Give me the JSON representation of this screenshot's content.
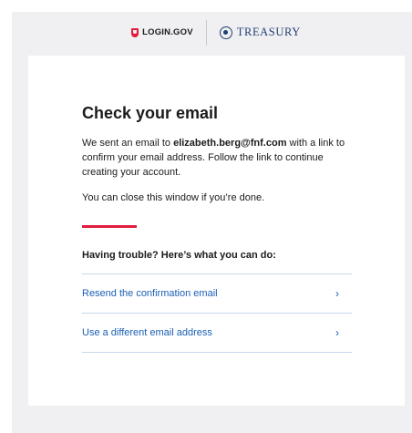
{
  "header": {
    "login_brand": "LOGIN.GOV",
    "partner_brand": "TREASURY"
  },
  "main": {
    "title": "Check your email",
    "message_prefix": "We sent an email to ",
    "email": "elizabeth.berg@fnf.com",
    "message_suffix": " with a link to confirm your email address. Follow the link to continue creating your account.",
    "close_note": "You can close this window if you’re done.",
    "trouble_heading": "Having trouble? Here’s what you can do:",
    "options": [
      {
        "label": "Resend the confirmation email",
        "icon": "chevron-right-icon",
        "glyph": "›"
      },
      {
        "label": "Use a different email address",
        "icon": "chevron-right-icon",
        "glyph": "›"
      }
    ]
  },
  "colors": {
    "accent_red": "#e21c3d",
    "link_blue": "#1a5fb4",
    "treasury_navy": "#1f3f73",
    "page_bg": "#f0f0f2"
  }
}
